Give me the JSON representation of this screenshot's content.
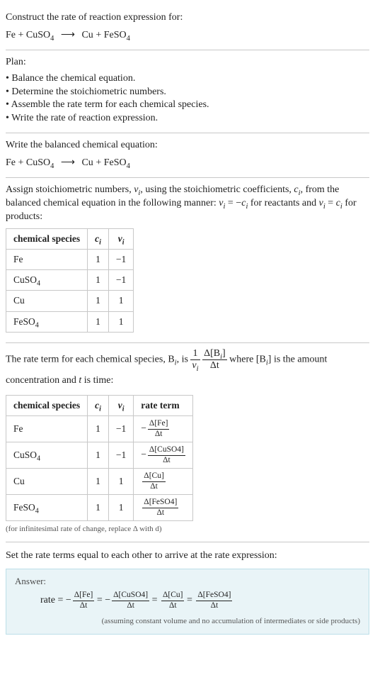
{
  "header": {
    "prompt": "Construct the rate of reaction expression for:"
  },
  "equation": {
    "r1": "Fe",
    "r2_base": "CuSO",
    "r2_sub": "4",
    "arrow": "⟶",
    "p1": "Cu",
    "p2_base": "FeSO",
    "p2_sub": "4"
  },
  "plan": {
    "label": "Plan:",
    "items": [
      "Balance the chemical equation.",
      "Determine the stoichiometric numbers.",
      "Assemble the rate term for each chemical species.",
      "Write the rate of reaction expression."
    ]
  },
  "balanced": {
    "label": "Write the balanced chemical equation:"
  },
  "stoich": {
    "intro_a": "Assign stoichiometric numbers, ",
    "nu_i": "ν",
    "nu_sub": "i",
    "intro_b": ", using the stoichiometric coefficients, ",
    "c_i": "c",
    "c_sub": "i",
    "intro_c": ", from the balanced chemical equation in the following manner: ",
    "rel_react": " = −",
    "rel_react_tail": " for reactants and ",
    "rel_prod_tail": " for products:",
    "eq_sign": " = "
  },
  "table1": {
    "headers": {
      "species": "chemical species",
      "c": "c",
      "c_sub": "i",
      "nu": "ν",
      "nu_sub": "i"
    },
    "rows": [
      {
        "species": "Fe",
        "species_sub": "",
        "c": "1",
        "nu": "−1"
      },
      {
        "species": "CuSO",
        "species_sub": "4",
        "c": "1",
        "nu": "−1"
      },
      {
        "species": "Cu",
        "species_sub": "",
        "c": "1",
        "nu": "1"
      },
      {
        "species": "FeSO",
        "species_sub": "4",
        "c": "1",
        "nu": "1"
      }
    ]
  },
  "rate_intro": {
    "a": "The rate term for each chemical species, B",
    "a_sub": "i",
    "b": ", is ",
    "where": " where [B",
    "where_sub": "i",
    "where_tail": "] is the amount concentration and ",
    "t_var": "t",
    "tail": " is time:"
  },
  "rate_frac": {
    "one": "1",
    "nu": "ν",
    "nu_sub": "i",
    "dB_top_a": "Δ[B",
    "dB_top_sub": "i",
    "dB_top_b": "]",
    "dB_bot": "Δt"
  },
  "table2": {
    "headers": {
      "species": "chemical species",
      "c": "c",
      "c_sub": "i",
      "nu": "ν",
      "nu_sub": "i",
      "rate": "rate term"
    },
    "rows": [
      {
        "species": "Fe",
        "species_sub": "",
        "c": "1",
        "nu": "−1",
        "sign": "−",
        "top": "Δ[Fe]",
        "bot": "Δt"
      },
      {
        "species": "CuSO",
        "species_sub": "4",
        "c": "1",
        "nu": "−1",
        "sign": "−",
        "top": "Δ[CuSO4]",
        "bot": "Δt"
      },
      {
        "species": "Cu",
        "species_sub": "",
        "c": "1",
        "nu": "1",
        "sign": "",
        "top": "Δ[Cu]",
        "bot": "Δt"
      },
      {
        "species": "FeSO",
        "species_sub": "4",
        "c": "1",
        "nu": "1",
        "sign": "",
        "top": "Δ[FeSO4]",
        "bot": "Δt"
      }
    ],
    "note": "(for infinitesimal rate of change, replace Δ with d)"
  },
  "final": {
    "label": "Set the rate terms equal to each other to arrive at the rate expression:"
  },
  "answer": {
    "label": "Answer:",
    "lead": "rate = ",
    "neg": "−",
    "eq": " = ",
    "terms": [
      {
        "sign": "−",
        "top": "Δ[Fe]",
        "bot": "Δt"
      },
      {
        "sign": "−",
        "top": "Δ[CuSO4]",
        "bot": "Δt"
      },
      {
        "sign": "",
        "top": "Δ[Cu]",
        "bot": "Δt"
      },
      {
        "sign": "",
        "top": "Δ[FeSO4]",
        "bot": "Δt"
      }
    ],
    "note": "(assuming constant volume and no accumulation of intermediates or side products)"
  }
}
